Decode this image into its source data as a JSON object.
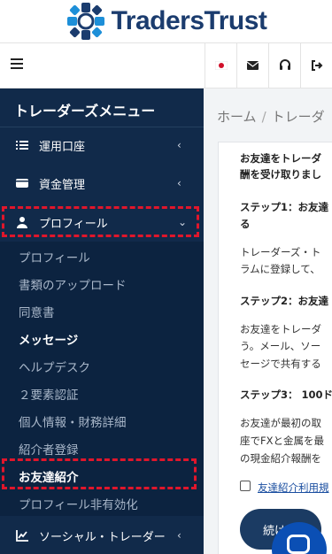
{
  "brand": {
    "name": "TradersTrust"
  },
  "header": {
    "icons": [
      "menu-icon",
      "japan-flag-icon",
      "envelope-icon",
      "headset-icon",
      "sign-out-icon"
    ]
  },
  "sidebar": {
    "title": "トレーダーズメニュー",
    "items": [
      {
        "label": "運用口座",
        "icon": "list-icon"
      },
      {
        "label": "資金管理",
        "icon": "wallet-icon"
      },
      {
        "label": "プロフィール",
        "icon": "user-icon",
        "expanded": true
      },
      {
        "label": "ソーシャル・トレーダー",
        "icon": "chart-line-icon"
      }
    ],
    "profile_submenu": [
      "プロフィール",
      "書類のアップロード",
      "同意書",
      "メッセージ",
      "ヘルプデスク",
      "２要素認証",
      "個人情報・財務詳細",
      "紹介者登録",
      "お友達紹介",
      "プロフィール非有効化"
    ]
  },
  "breadcrumb": {
    "home": "ホーム",
    "separator": "/",
    "current": "トレーダ"
  },
  "content": {
    "intro_line1": "お友達をトレーダ",
    "intro_line2": "酬を受け取りまし",
    "step1_title_l1": "ステップ1：お友達",
    "step1_title_l2": "る",
    "step1_body_l1": "トレーダーズ・ト",
    "step1_body_l2": "ラムに登録して、",
    "step2_title": "ステップ2：お友達",
    "step2_body_l1": "お友達をトレーダ",
    "step2_body_l2": "う。メール、ソー",
    "step2_body_l3": "セージで共有する",
    "step3_title": "ステップ3： 100ド",
    "step3_body_l1": "お友達が最初の取",
    "step3_body_l2": "座でFXと金属を最",
    "step3_body_l3": "の現金紹介報酬を",
    "terms_link": "友達紹介利用規",
    "continue_label": "続け"
  },
  "colors": {
    "sidebar_bg": "#112a4a",
    "highlight": "#e0162b",
    "brand": "#1b3c6e",
    "fab": "#0b4fb4"
  }
}
